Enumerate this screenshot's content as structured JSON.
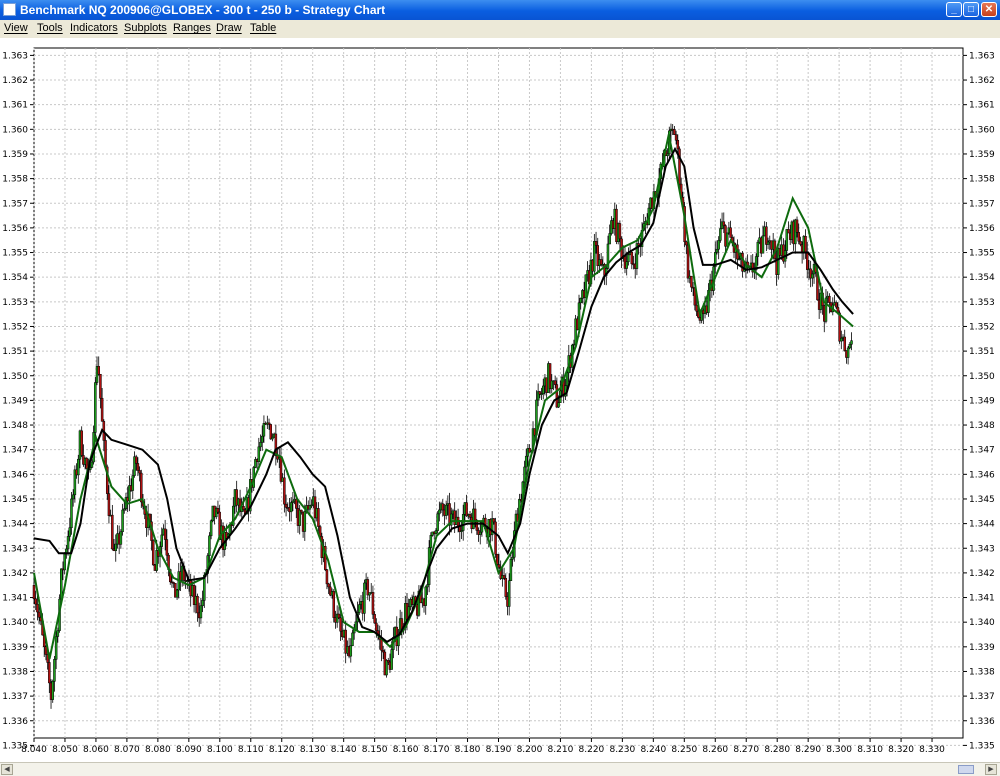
{
  "window": {
    "title": "Benchmark NQ 200906@GLOBEX - 300 t - 250 b - Strategy Chart",
    "buttons": {
      "minimize": "_",
      "maximize": "□",
      "close": "✕"
    }
  },
  "menu": [
    "View",
    "Tools",
    "Indicators",
    "Subplots",
    "Ranges",
    "Draw",
    "Table"
  ],
  "scroll": {
    "left_arrow": "◀",
    "right_arrow": "▶"
  },
  "colors": {
    "up_candle": "#1c9e1c",
    "down_candle": "#b01010",
    "ma_black": "#000000",
    "ma_green": "#0e6b0e",
    "grid": "#c8c8c8"
  },
  "chart_data": {
    "type": "candlestick",
    "xlim": [
      8.04,
      8.34
    ],
    "ylim": [
      1.3353,
      1.3633
    ],
    "x_ticks": [
      "8.040",
      "8.050",
      "8.060",
      "8.070",
      "8.080",
      "8.090",
      "8.100",
      "8.110",
      "8.120",
      "8.130",
      "8.140",
      "8.150",
      "8.160",
      "8.170",
      "8.180",
      "8.190",
      "8.200",
      "8.210",
      "8.220",
      "8.230",
      "8.240",
      "8.250",
      "8.260",
      "8.270",
      "8.280",
      "8.290",
      "8.300",
      "8.310",
      "8.320",
      "8.330"
    ],
    "y_ticks": [
      "1.363",
      "1.362",
      "1.361",
      "1.360",
      "1.359",
      "1.358",
      "1.357",
      "1.356",
      "1.355",
      "1.354",
      "1.353",
      "1.352",
      "1.351",
      "1.350",
      "1.349",
      "1.348",
      "1.347",
      "1.346",
      "1.345",
      "1.344",
      "1.343",
      "1.342",
      "1.341",
      "1.340",
      "1.339",
      "1.338",
      "1.337",
      "1.336",
      "1.335"
    ],
    "price_path": [
      [
        8.04,
        1.3415
      ],
      [
        8.0455,
        1.337
      ],
      [
        8.049,
        1.342
      ],
      [
        8.052,
        1.3445
      ],
      [
        8.055,
        1.3475
      ],
      [
        8.058,
        1.3455
      ],
      [
        8.0605,
        1.351
      ],
      [
        8.0625,
        1.347
      ],
      [
        8.066,
        1.3425
      ],
      [
        8.07,
        1.345
      ],
      [
        8.073,
        1.3465
      ],
      [
        8.076,
        1.3445
      ],
      [
        8.079,
        1.3425
      ],
      [
        8.082,
        1.344
      ],
      [
        8.085,
        1.341
      ],
      [
        8.088,
        1.342
      ],
      [
        8.091,
        1.341
      ],
      [
        8.094,
        1.3405
      ],
      [
        8.098,
        1.3445
      ],
      [
        8.102,
        1.343
      ],
      [
        8.105,
        1.345
      ],
      [
        8.108,
        1.344
      ],
      [
        8.112,
        1.347
      ],
      [
        8.116,
        1.348
      ],
      [
        8.119,
        1.347
      ],
      [
        8.121,
        1.345
      ],
      [
        8.124,
        1.3445
      ],
      [
        8.127,
        1.344
      ],
      [
        8.13,
        1.345
      ],
      [
        8.133,
        1.343
      ],
      [
        8.136,
        1.341
      ],
      [
        8.139,
        1.3395
      ],
      [
        8.142,
        1.3385
      ],
      [
        8.145,
        1.3405
      ],
      [
        8.148,
        1.3415
      ],
      [
        8.151,
        1.3395
      ],
      [
        8.154,
        1.338
      ],
      [
        8.157,
        1.3395
      ],
      [
        8.16,
        1.3405
      ],
      [
        8.163,
        1.3405
      ],
      [
        8.166,
        1.341
      ],
      [
        8.169,
        1.344
      ],
      [
        8.172,
        1.3445
      ],
      [
        8.176,
        1.344
      ],
      [
        8.18,
        1.3445
      ],
      [
        8.184,
        1.344
      ],
      [
        8.188,
        1.344
      ],
      [
        8.191,
        1.3415
      ],
      [
        8.193,
        1.341
      ],
      [
        8.196,
        1.3445
      ],
      [
        8.2,
        1.347
      ],
      [
        8.203,
        1.349
      ],
      [
        8.206,
        1.35
      ],
      [
        8.209,
        1.349
      ],
      [
        8.212,
        1.35
      ],
      [
        8.215,
        1.352
      ],
      [
        8.218,
        1.3535
      ],
      [
        8.221,
        1.355
      ],
      [
        8.224,
        1.354
      ],
      [
        8.227,
        1.3565
      ],
      [
        8.23,
        1.355
      ],
      [
        8.233,
        1.3545
      ],
      [
        8.236,
        1.3555
      ],
      [
        8.239,
        1.357
      ],
      [
        8.242,
        1.358
      ],
      [
        8.245,
        1.3595
      ],
      [
        8.247,
        1.36
      ],
      [
        8.249,
        1.3575
      ],
      [
        8.251,
        1.3545
      ],
      [
        8.253,
        1.353
      ],
      [
        8.256,
        1.352
      ],
      [
        8.259,
        1.354
      ],
      [
        8.262,
        1.356
      ],
      [
        8.265,
        1.3555
      ],
      [
        8.268,
        1.3545
      ],
      [
        8.271,
        1.354
      ],
      [
        8.274,
        1.355
      ],
      [
        8.277,
        1.356
      ],
      [
        8.28,
        1.3545
      ],
      [
        8.283,
        1.3555
      ],
      [
        8.286,
        1.356
      ],
      [
        8.289,
        1.355
      ],
      [
        8.292,
        1.354
      ],
      [
        8.295,
        1.3525
      ],
      [
        8.298,
        1.353
      ],
      [
        8.301,
        1.3515
      ],
      [
        8.303,
        1.351
      ],
      [
        8.3045,
        1.3522
      ]
    ],
    "series": [
      {
        "values": [
          [
            8.04,
            1.3434
          ],
          [
            8.045,
            1.3433
          ],
          [
            8.048,
            1.3428
          ],
          [
            8.052,
            1.3428
          ],
          [
            8.055,
            1.344
          ],
          [
            8.058,
            1.3465
          ],
          [
            8.062,
            1.3478
          ],
          [
            8.065,
            1.3474
          ],
          [
            8.07,
            1.3472
          ],
          [
            8.075,
            1.347
          ],
          [
            8.08,
            1.3464
          ],
          [
            8.083,
            1.345
          ],
          [
            8.086,
            1.343
          ],
          [
            8.09,
            1.3417
          ],
          [
            8.095,
            1.3418
          ],
          [
            8.1,
            1.343
          ],
          [
            8.105,
            1.3438
          ],
          [
            8.11,
            1.3447
          ],
          [
            8.115,
            1.346
          ],
          [
            8.118,
            1.347
          ],
          [
            8.122,
            1.3473
          ],
          [
            8.126,
            1.3467
          ],
          [
            8.13,
            1.346
          ],
          [
            8.134,
            1.3455
          ],
          [
            8.138,
            1.3435
          ],
          [
            8.142,
            1.341
          ],
          [
            8.146,
            1.3398
          ],
          [
            8.15,
            1.3396
          ],
          [
            8.154,
            1.3392
          ],
          [
            8.158,
            1.3395
          ],
          [
            8.162,
            1.3404
          ],
          [
            8.166,
            1.3417
          ],
          [
            8.17,
            1.343
          ],
          [
            8.175,
            1.3438
          ],
          [
            8.18,
            1.344
          ],
          [
            8.185,
            1.344
          ],
          [
            8.19,
            1.3435
          ],
          [
            8.193,
            1.3428
          ],
          [
            8.197,
            1.344
          ],
          [
            8.2,
            1.346
          ],
          [
            8.204,
            1.348
          ],
          [
            8.208,
            1.349
          ],
          [
            8.212,
            1.3493
          ],
          [
            8.216,
            1.351
          ],
          [
            8.22,
            1.3528
          ],
          [
            8.224,
            1.354
          ],
          [
            8.228,
            1.3546
          ],
          [
            8.232,
            1.355
          ],
          [
            8.236,
            1.3553
          ],
          [
            8.24,
            1.3562
          ],
          [
            8.244,
            1.3585
          ],
          [
            8.247,
            1.3592
          ],
          [
            8.25,
            1.3585
          ],
          [
            8.253,
            1.356
          ],
          [
            8.256,
            1.3545
          ],
          [
            8.26,
            1.3545
          ],
          [
            8.265,
            1.3547
          ],
          [
            8.27,
            1.3543
          ],
          [
            8.275,
            1.3544
          ],
          [
            8.28,
            1.3547
          ],
          [
            8.285,
            1.355
          ],
          [
            8.29,
            1.355
          ],
          [
            8.294,
            1.3543
          ],
          [
            8.298,
            1.3535
          ],
          [
            8.301,
            1.353
          ],
          [
            8.3045,
            1.3525
          ]
        ]
      },
      {
        "values": [
          [
            8.04,
            1.342
          ],
          [
            8.045,
            1.3385
          ],
          [
            8.05,
            1.3415
          ],
          [
            8.055,
            1.345
          ],
          [
            8.06,
            1.3475
          ],
          [
            8.065,
            1.3455
          ],
          [
            8.07,
            1.3448
          ],
          [
            8.075,
            1.345
          ],
          [
            8.08,
            1.343
          ],
          [
            8.085,
            1.3418
          ],
          [
            8.09,
            1.3415
          ],
          [
            8.095,
            1.3418
          ],
          [
            8.1,
            1.3435
          ],
          [
            8.105,
            1.3442
          ],
          [
            8.11,
            1.3455
          ],
          [
            8.115,
            1.347
          ],
          [
            8.12,
            1.3467
          ],
          [
            8.125,
            1.345
          ],
          [
            8.13,
            1.3442
          ],
          [
            8.135,
            1.3425
          ],
          [
            8.14,
            1.34
          ],
          [
            8.145,
            1.3396
          ],
          [
            8.15,
            1.3396
          ],
          [
            8.155,
            1.339
          ],
          [
            8.16,
            1.3398
          ],
          [
            8.165,
            1.3412
          ],
          [
            8.17,
            1.3435
          ],
          [
            8.175,
            1.3441
          ],
          [
            8.18,
            1.3441
          ],
          [
            8.185,
            1.3441
          ],
          [
            8.19,
            1.342
          ],
          [
            8.195,
            1.343
          ],
          [
            8.2,
            1.3465
          ],
          [
            8.205,
            1.349
          ],
          [
            8.21,
            1.3495
          ],
          [
            8.215,
            1.3512
          ],
          [
            8.22,
            1.354
          ],
          [
            8.225,
            1.3545
          ],
          [
            8.23,
            1.3552
          ],
          [
            8.235,
            1.3555
          ],
          [
            8.24,
            1.3568
          ],
          [
            8.245,
            1.3598
          ],
          [
            8.25,
            1.3565
          ],
          [
            8.255,
            1.3525
          ],
          [
            8.26,
            1.354
          ],
          [
            8.265,
            1.3555
          ],
          [
            8.27,
            1.3545
          ],
          [
            8.275,
            1.354
          ],
          [
            8.28,
            1.3552
          ],
          [
            8.285,
            1.3572
          ],
          [
            8.29,
            1.356
          ],
          [
            8.295,
            1.353
          ],
          [
            8.3,
            1.3525
          ],
          [
            8.3045,
            1.352
          ]
        ]
      }
    ]
  }
}
